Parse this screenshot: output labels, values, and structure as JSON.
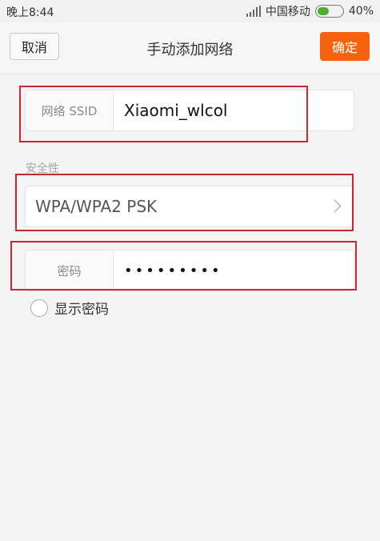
{
  "status_bar": {
    "time": "晚上8:44",
    "carrier": "中国移动",
    "battery": "40%",
    "icons": [
      "signal-icon",
      "battery-icon"
    ]
  },
  "header": {
    "cancel_label": "取消",
    "title": "手动添加网络",
    "confirm_label": "确定"
  },
  "form": {
    "ssid_label": "网络 SSID",
    "ssid_value": "Xiaomi_wlcol",
    "security_section_label": "安全性",
    "security_value": "WPA/WPA2 PSK",
    "password_label": "密码",
    "password_value": "•••••••••",
    "show_password_label": "显示密码"
  },
  "colors": {
    "confirm_bg": "#f6630f",
    "annotation": "#c8282f",
    "battery_fill": "#4caf2c"
  }
}
